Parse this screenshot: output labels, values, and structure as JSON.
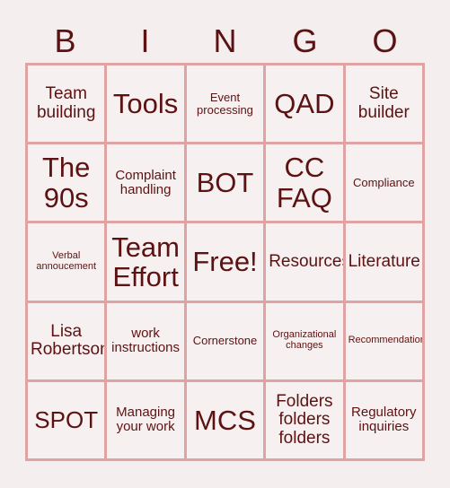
{
  "colors": {
    "page_background": "#f4eeee",
    "cell_background": "#f7f0f0",
    "grid_line": "#dfa3a3",
    "text": "#5c1212"
  },
  "header": {
    "letters": [
      "B",
      "I",
      "N",
      "G",
      "O"
    ]
  },
  "grid": {
    "columns": 5,
    "rows": 5,
    "cells": [
      {
        "text": "Team\nbuilding",
        "size": "md",
        "column": "B",
        "row": 1
      },
      {
        "text": "Tools",
        "size": "xl",
        "column": "I",
        "row": 1
      },
      {
        "text": "Event\nprocessing",
        "size": "xs",
        "column": "N",
        "row": 1
      },
      {
        "text": "QAD",
        "size": "xl",
        "column": "G",
        "row": 1
      },
      {
        "text": "Site\nbuilder",
        "size": "md",
        "column": "O",
        "row": 1
      },
      {
        "text": "The\n90s",
        "size": "xl",
        "column": "B",
        "row": 2
      },
      {
        "text": "Complaint\nhandling",
        "size": "sm",
        "column": "I",
        "row": 2
      },
      {
        "text": "BOT",
        "size": "xl",
        "column": "N",
        "row": 2
      },
      {
        "text": "CC\nFAQ",
        "size": "xl",
        "column": "G",
        "row": 2
      },
      {
        "text": "Compliance",
        "size": "xs",
        "column": "O",
        "row": 2
      },
      {
        "text": "Verbal\nannoucement",
        "size": "xxs",
        "column": "B",
        "row": 3
      },
      {
        "text": "Team\nEffort",
        "size": "xl",
        "column": "I",
        "row": 3
      },
      {
        "text": "Free!",
        "size": "xl",
        "column": "N",
        "row": 3
      },
      {
        "text": "Resources",
        "size": "md",
        "column": "G",
        "row": 3
      },
      {
        "text": "Literature",
        "size": "md",
        "column": "O",
        "row": 3
      },
      {
        "text": "Lisa\nRobertson",
        "size": "md",
        "column": "B",
        "row": 4
      },
      {
        "text": "work\ninstructions",
        "size": "sm",
        "column": "I",
        "row": 4
      },
      {
        "text": "Cornerstone",
        "size": "xs",
        "column": "N",
        "row": 4
      },
      {
        "text": "Organizational\nchanges",
        "size": "xxs",
        "column": "G",
        "row": 4
      },
      {
        "text": "Recommendations",
        "size": "xxs",
        "column": "O",
        "row": 4
      },
      {
        "text": "SPOT",
        "size": "lg",
        "column": "B",
        "row": 5
      },
      {
        "text": "Managing\nyour work",
        "size": "sm",
        "column": "I",
        "row": 5
      },
      {
        "text": "MCS",
        "size": "xl",
        "column": "N",
        "row": 5
      },
      {
        "text": "Folders\nfolders\nfolders",
        "size": "md",
        "column": "G",
        "row": 5
      },
      {
        "text": "Regulatory\ninquiries",
        "size": "sm",
        "column": "O",
        "row": 5
      }
    ]
  }
}
